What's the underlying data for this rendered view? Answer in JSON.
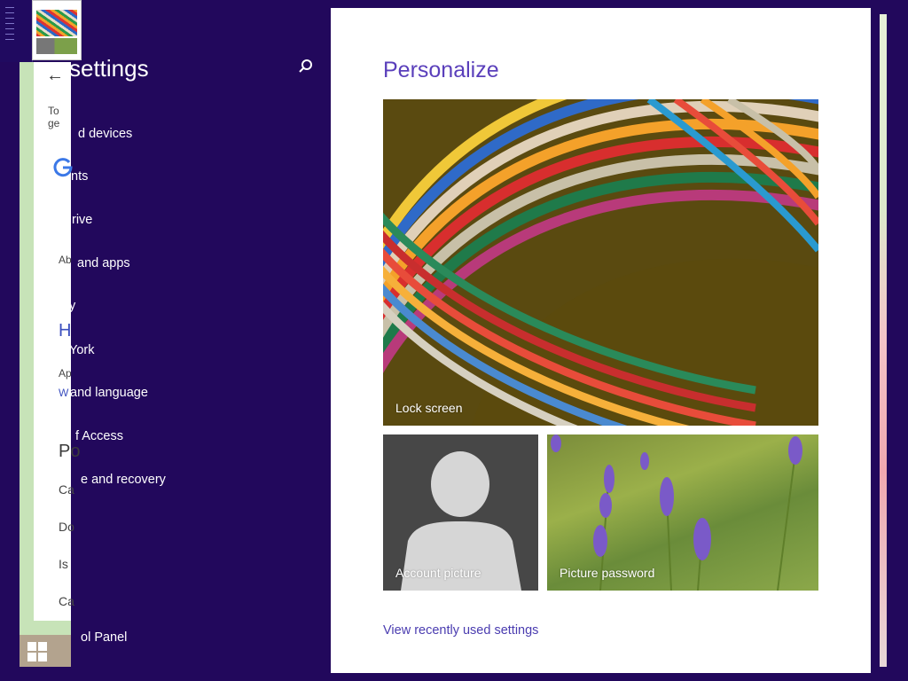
{
  "nav": {
    "title": "settings",
    "items": [
      {
        "label": "d devices"
      },
      {
        "label": "nts"
      },
      {
        "label": "rive"
      },
      {
        "label": "and apps"
      },
      {
        "label": "y"
      },
      {
        "label": "York"
      },
      {
        "label": "and language"
      },
      {
        "label": "f Access"
      },
      {
        "label": "e and recovery"
      },
      {
        "label": "ol Panel"
      }
    ],
    "search_icon": "search-icon"
  },
  "background_window": {
    "snippets": [
      "To ge",
      "Ab",
      "H",
      "Ap",
      "W",
      "Po",
      "Ca",
      "Do",
      "Is",
      "Ca"
    ]
  },
  "main": {
    "title": "Personalize",
    "tiles": [
      {
        "label": "Lock screen"
      },
      {
        "label": "Account picture"
      },
      {
        "label": "Picture password"
      }
    ],
    "recent_link": "View recently used settings"
  },
  "colors": {
    "background": "#22085c",
    "accent": "#5a3fbb",
    "link": "#4a3cb0"
  }
}
